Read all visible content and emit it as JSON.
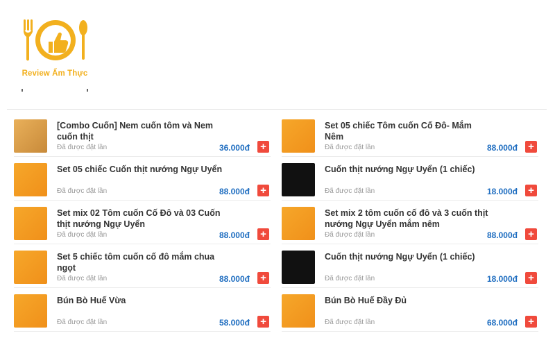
{
  "logo": {
    "text": "Review Ẩm Thực"
  },
  "colors": {
    "brand": "#f2b01e",
    "price": "#1e6dc0",
    "add_button": "#f04a3c",
    "sub_text": "#999999"
  },
  "menu": {
    "left": [
      {
        "name": "[Combo Cuốn] Nem cuốn tôm và Nem cuốn thịt",
        "sub": "Đã được đặt lần",
        "price": "36.000đ",
        "add": "+",
        "thumb": "warm"
      },
      {
        "name": "Set 05 chiếc Cuốn thịt nướng Ngự Uyển",
        "sub": "Đã được đặt lần",
        "price": "88.000đ",
        "add": "+",
        "thumb": "orange"
      },
      {
        "name": "Set mix 02 Tôm cuốn Cố Đô và 03 Cuốn thịt nướng Ngự Uyển",
        "sub": "Đã được đặt lần",
        "price": "88.000đ",
        "add": "+",
        "thumb": "orange"
      },
      {
        "name": "Set 5 chiếc tôm cuốn cố đô mắm chua ngọt",
        "sub": "Đã được đặt lần",
        "price": "88.000đ",
        "add": "+",
        "thumb": "orange"
      },
      {
        "name": "Bún Bò Huế Vừa",
        "sub": "Đã được đặt lần",
        "price": "58.000đ",
        "add": "+",
        "thumb": "orange"
      }
    ],
    "right": [
      {
        "name": "Set 05 chiếc Tôm cuốn Cố Đô- Mắm Nêm",
        "sub": "Đã được đặt lần",
        "price": "88.000đ",
        "add": "+",
        "thumb": "orange"
      },
      {
        "name": "Cuốn thịt nướng Ngự Uyển (1 chiếc)",
        "sub": "Đã được đặt lần",
        "price": "18.000đ",
        "add": "+",
        "thumb": "dark"
      },
      {
        "name": "Set mix 2 tôm cuốn cố đô và 3 cuốn thịt nướng Ngự Uyển mắm nêm",
        "sub": "Đã được đặt lần",
        "price": "88.000đ",
        "add": "+",
        "thumb": "orange"
      },
      {
        "name": "Cuốn thịt nướng Ngự Uyển (1 chiếc)",
        "sub": "Đã được đặt lần",
        "price": "18.000đ",
        "add": "+",
        "thumb": "dark"
      },
      {
        "name": "Bún Bò Huế Đầy Đủ",
        "sub": "Đã được đặt lần",
        "price": "68.000đ",
        "add": "+",
        "thumb": "orange"
      }
    ]
  }
}
